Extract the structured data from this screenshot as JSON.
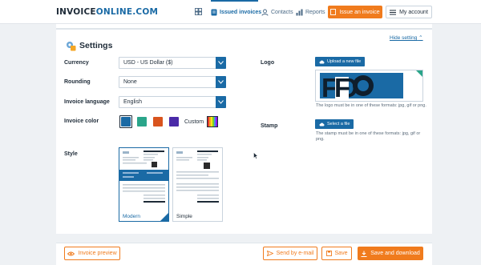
{
  "header": {
    "logo_part1": "INVOICE",
    "logo_part2": "ONLINE.COM",
    "nav": [
      {
        "label": "Issued invoices",
        "icon": "invoice-icon",
        "active": true
      },
      {
        "label": "Contacts",
        "icon": "contacts-icon",
        "active": false
      },
      {
        "label": "Reports",
        "icon": "reports-icon",
        "active": false
      }
    ],
    "issue_label": "Issue an invoice",
    "account_label": "My account"
  },
  "settings": {
    "title": "Settings",
    "hide_label": "Hide setting",
    "currency": {
      "label": "Currency",
      "value": "USD - US Dollar ($)"
    },
    "rounding": {
      "label": "Rounding",
      "value": "None"
    },
    "language": {
      "label": "Invoice language",
      "value": "English"
    },
    "color": {
      "label": "Invoice color",
      "swatches": [
        "#1a6aa5",
        "#2aa58a",
        "#d9541e",
        "#4a2aa8"
      ],
      "selected_index": 0,
      "custom_label": "Custom"
    },
    "style": {
      "label": "Style",
      "options": [
        "Modern",
        "Simple"
      ],
      "selected": "Modern"
    },
    "logo": {
      "label": "Logo",
      "upload_label": "Upload a new file",
      "hint": "The logo must be in one of these formats: jpg, gif or png.",
      "preview_text": "FO"
    },
    "stamp": {
      "label": "Stamp",
      "upload_label": "Select a file",
      "hint": "The stamp must be in one of these formats: jpg, gif or png."
    }
  },
  "footer": {
    "preview_label": "Invoice preview",
    "email_label": "Send by e-mail",
    "save_label": "Save",
    "save_download_label": "Save and download"
  },
  "colors": {
    "accent": "#1a6aa5",
    "brand_orange": "#f07b1d"
  }
}
